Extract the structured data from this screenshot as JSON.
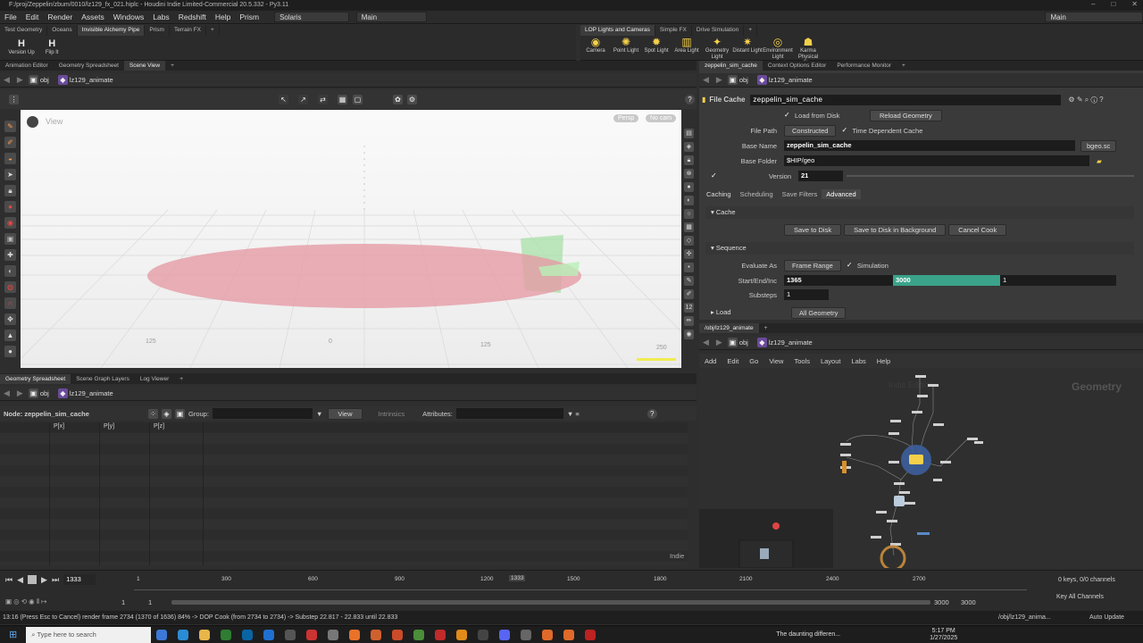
{
  "title": "F:/proj/Zeppelin/zbum/0010/lz129_fx_021.hiplc - Houdini Indie Limited-Commercial 20.5.332 - Py3.11",
  "menu": [
    "File",
    "Edit",
    "Render",
    "Assets",
    "Windows",
    "Labs",
    "Redshift",
    "Help",
    "Prism"
  ],
  "desktop_sel": "Solaris",
  "context_sel": "Main",
  "right_desktop": "Main",
  "shelf_tabs_left": [
    "Test Geometry",
    "Oceans",
    "Invisible Alchemy Pipe",
    "Prism",
    "Terrain FX"
  ],
  "shelf_tools_left": [
    {
      "icon": "H",
      "label": "Version Up"
    },
    {
      "icon": "H",
      "label": "Flip It"
    }
  ],
  "shelf_tabs_right": [
    "LOP Lights and Cameras",
    "Simple FX",
    "Drive Simulation"
  ],
  "shelf_tools_right": [
    "Camera",
    "Point Light",
    "Spot Light",
    "Area Light",
    "Geometry Light",
    "Distant Light",
    "Environment Light",
    "Karma Physical Sk..."
  ],
  "left_tabs": [
    "Animation Editor",
    "Geometry Spreadsheet",
    "Scene View"
  ],
  "right_tabs": [
    "zeppelin_sim_cache",
    "Context Options Editor",
    "Performance Monitor"
  ],
  "path_obj": "obj",
  "path_node": "lz129_animate",
  "viewport": {
    "label": "View",
    "persp": "Persp",
    "cam": "No cam",
    "ruler": [
      "125",
      "0",
      "125",
      "250"
    ]
  },
  "params": {
    "type": "File Cache",
    "name": "zeppelin_sim_cache",
    "load_from_disk": "Load from Disk",
    "reload": "Reload Geometry",
    "file_path_label": "File Path",
    "file_path": "Constructed",
    "time_dep": "Time Dependent Cache",
    "base_name_label": "Base Name",
    "base_name": "zeppelin_sim_cache",
    "ext": "bgeo.sc",
    "base_folder_label": "Base Folder",
    "base_folder": "$HIP/geo",
    "version_label": "Version",
    "version": "21",
    "tabs": [
      "Caching",
      "Scheduling",
      "Save Filters",
      "Advanced"
    ],
    "cache_section": "Cache",
    "save": "Save to Disk",
    "save_bg": "Save to Disk in Background",
    "cancel": "Cancel Cook",
    "seq_section": "Sequence",
    "eval_label": "Evaluate As",
    "eval": "Frame Range",
    "simulation": "Simulation",
    "sei_label": "Start/End/Inc",
    "start": "1365",
    "end": "3000",
    "inc": "1",
    "substeps_label": "Substeps",
    "substeps": "1",
    "load_section": "Load",
    "load_val": "All Geometry"
  },
  "ss_tabs": [
    "Geometry Spreadsheet",
    "Scene Graph Layers",
    "Log Viewer"
  ],
  "ss": {
    "node": "Node: zeppelin_sim_cache",
    "group": "Group:",
    "view": "View",
    "intrinsics": "Intrinsics",
    "attributes": "Attributes:",
    "cols": [
      "P[x]",
      "P[y]",
      "P[z]"
    ],
    "indie": "Indie"
  },
  "net_tab": "/obj/lz129_animate",
  "net_menu": [
    "Add",
    "Edit",
    "Go",
    "View",
    "Tools",
    "Layout",
    "Labs",
    "Help"
  ],
  "net_label": "Geometry",
  "net_watermark": "Indie Edition",
  "timeline": {
    "frame": "1333",
    "ticks": [
      "1",
      "300",
      "600",
      "900",
      "1200",
      "1500",
      "1800",
      "2100",
      "2400",
      "2700"
    ],
    "marker": "1333",
    "start": "1",
    "start2": "1",
    "end": "3000",
    "end2": "3000",
    "keys": "0 keys, 0/0 channels",
    "key_all": "Key All Channels",
    "auto": "Auto Update"
  },
  "status": "13:16 (Press Esc to Cancel) render frame 2734 (1370 of 1636) 84% -> DOP Cook (from 2734 to 2734) -> Substep 22.817 - 22.833 until 22.833",
  "net_path_status": "/obj/lz129_anima...",
  "taskbar": {
    "search": "Type here to search",
    "news": "The daunting differen...",
    "time": "5:17 PM",
    "date": "1/27/2025"
  }
}
